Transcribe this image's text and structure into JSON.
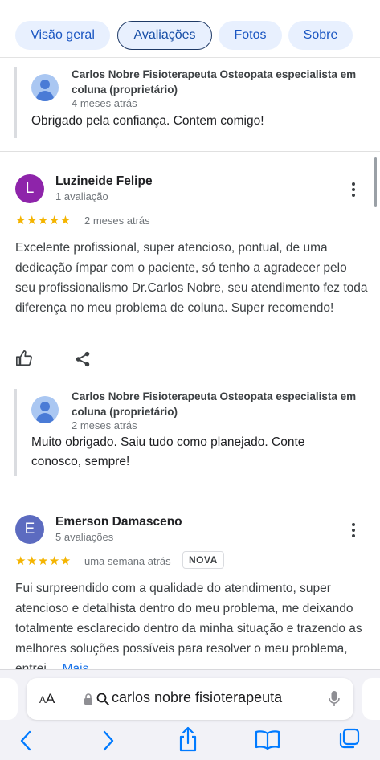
{
  "tabs": [
    {
      "label": "Visão geral"
    },
    {
      "label": "Avaliações"
    },
    {
      "label": "Fotos"
    },
    {
      "label": "Sobre"
    }
  ],
  "colors": {
    "accent": "#1a73e8",
    "star": "#f4b400",
    "avatar_l": "#8e24aa",
    "avatar_e": "#5c6bc0"
  },
  "reply_prev": {
    "owner": "Carlos Nobre Fisioterapeuta Osteopata especialista em coluna (proprietário)",
    "time": "4 meses atrás",
    "text": "Obrigado pela confiança. Contem comigo!"
  },
  "review1": {
    "initial": "L",
    "author": "Luzineide Felipe",
    "meta": "1 avaliação",
    "stars": "★★★★★",
    "rating": 5,
    "when": "2 meses atrás",
    "text": "Excelente profissional, super atencioso, pontual, de uma dedicação ímpar com o paciente, só tenho a agradecer pelo seu profissionalismo Dr.Carlos Nobre, seu atendimento fez toda diferença no meu problema de coluna. Super recomendo!",
    "reply": {
      "owner": "Carlos Nobre Fisioterapeuta Osteopata especialista em coluna (proprietário)",
      "time": "2 meses atrás",
      "text": "Muito obrigado. Saiu tudo como planejado. Conte conosco, sempre!"
    }
  },
  "review2": {
    "initial": "E",
    "author": "Emerson Damasceno",
    "meta": "5 avaliações",
    "stars": "★★★★★",
    "rating": 5,
    "when": "uma semana atrás",
    "badge": "NOVA",
    "text": "Fui surpreendido com a qualidade do atendimento, super atencioso e detalhista dentro do meu problema, me deixando totalmente esclarecido dentro da minha situação e trazendo as melhores soluções possíveis para resolver o meu problema, entrei …",
    "more": "Mais"
  },
  "browser": {
    "aa_small": "A",
    "aa_big": "A",
    "url": "carlos nobre fisioterapeuta"
  }
}
